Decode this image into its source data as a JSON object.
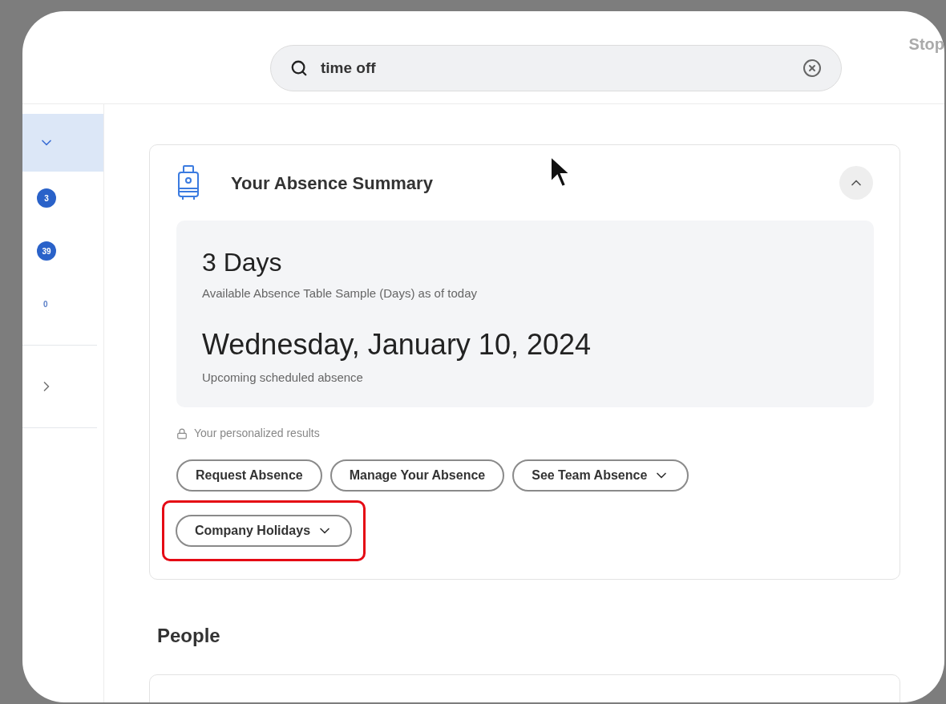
{
  "search": {
    "value": "time off"
  },
  "top_right_text": "Stop",
  "sidebar": {
    "items": [
      {
        "kind": "toggle",
        "selected": true
      },
      {
        "kind": "badge",
        "count": "3",
        "selected": false
      },
      {
        "kind": "badge",
        "count": "39",
        "selected": false
      },
      {
        "kind": "count",
        "count": "0",
        "selected": false
      },
      {
        "kind": "expand",
        "selected": false
      }
    ]
  },
  "absence_card": {
    "title": "Your Absence Summary",
    "expanded": true,
    "summary": [
      {
        "value": "3 Days",
        "caption": "Available Absence Table Sample (Days) as of today",
        "kind": "count"
      },
      {
        "value": "Wednesday, January 10, 2024",
        "caption": "Upcoming scheduled absence",
        "kind": "date"
      }
    ],
    "note": "Your personalized results",
    "actions": [
      {
        "label": "Request Absence",
        "dropdown": false,
        "highlighted": false
      },
      {
        "label": "Manage Your Absence",
        "dropdown": false,
        "highlighted": false
      },
      {
        "label": "See Team Absence",
        "dropdown": true,
        "highlighted": false
      },
      {
        "label": "Company Holidays",
        "dropdown": true,
        "highlighted": true
      }
    ]
  },
  "people_section": {
    "title": "People"
  }
}
